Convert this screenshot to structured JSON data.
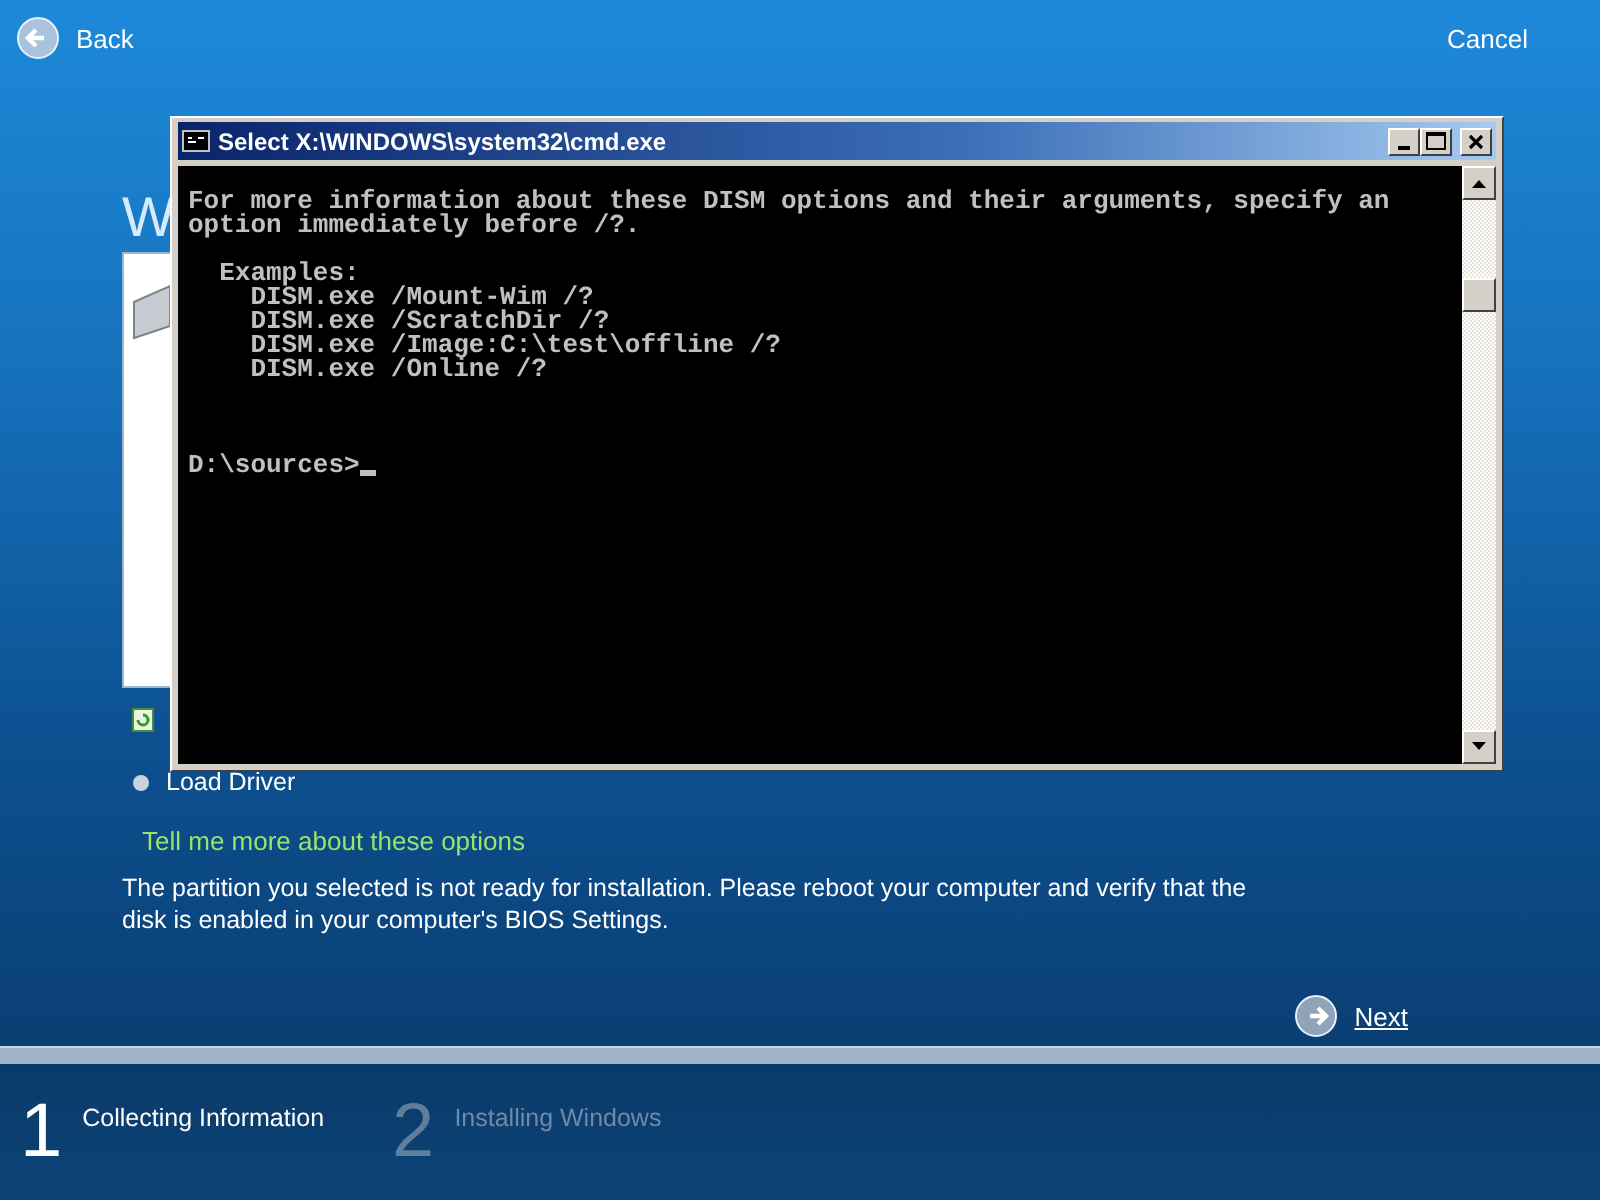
{
  "nav": {
    "back": "Back",
    "cancel": "Cancel"
  },
  "page": {
    "heading": "W",
    "load_driver": "Load Driver",
    "help_link": "Tell me more about these options",
    "message": "The partition you selected is not ready for installation. Please reboot your computer and verify that the disk is enabled in your computer's BIOS Settings.",
    "next": "Next"
  },
  "console_window": {
    "title": "Select X:\\WINDOWS\\system32\\cmd.exe",
    "blocks": [
      {
        "kind": "paragraph",
        "text": "For more information about these DISM options and their arguments, specify an option immediately before /?."
      },
      {
        "kind": "examples",
        "title": "Examples:",
        "items": [
          "DISM.exe /Mount-Wim /?",
          "DISM.exe /ScratchDir /?",
          "DISM.exe /Image:C:\\test\\offline /?",
          "DISM.exe /Online /?"
        ]
      },
      {
        "kind": "prompt",
        "text": "D:\\sources>"
      }
    ]
  },
  "steps": [
    {
      "number": "1",
      "label": "Collecting Information",
      "selected": true
    },
    {
      "number": "2",
      "label": "Installing Windows",
      "selected": false
    }
  ]
}
